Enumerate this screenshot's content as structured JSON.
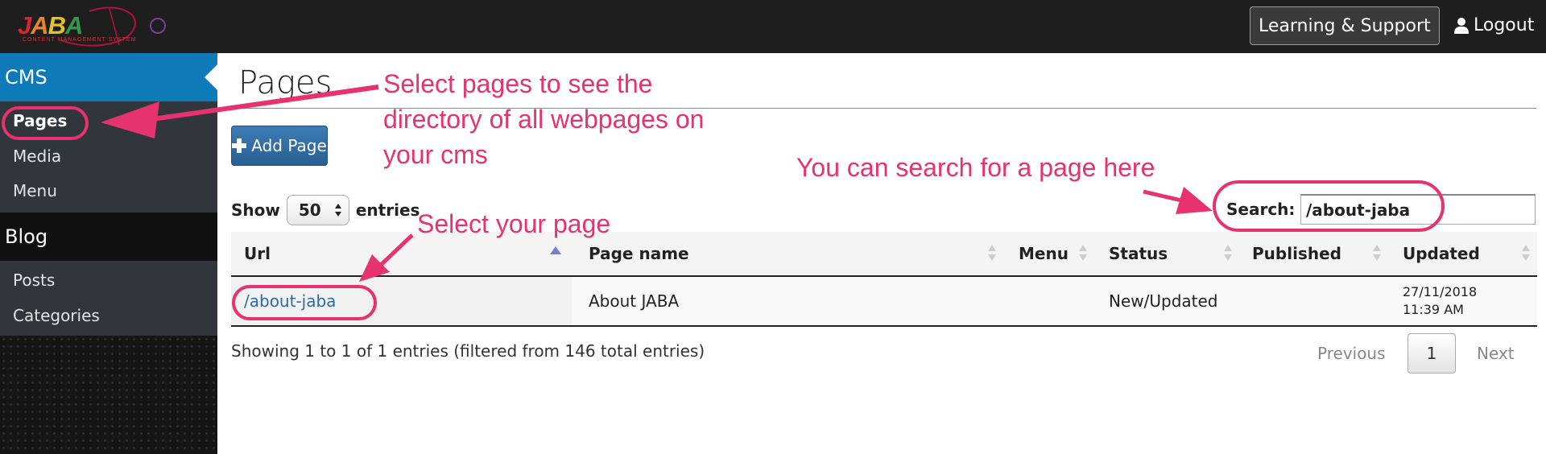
{
  "topbar": {
    "logo_text": "JABA",
    "logo_tagline": "CONTENT MANAGEMENT SYSTEM",
    "learning_label": "Learning & Support",
    "logout_label": "Logout"
  },
  "sidebar": {
    "sections": [
      {
        "label": "CMS",
        "items": [
          "Pages",
          "Media",
          "Menu"
        ]
      },
      {
        "label": "Blog",
        "items": [
          "Posts",
          "Categories"
        ]
      }
    ]
  },
  "main": {
    "title": "Pages",
    "add_button": "Add Page",
    "show_label": "Show",
    "entries_value": "50",
    "entries_label": "entries",
    "search_label": "Search:",
    "search_value": "/about-jaba",
    "columns": [
      "Url",
      "Page name",
      "Menu",
      "Status",
      "Published",
      "Updated"
    ],
    "rows": [
      {
        "url": "/about-jaba",
        "page_name": "About JABA",
        "menu": "",
        "status": "New/Updated",
        "published": "",
        "updated_date": "27/11/2018",
        "updated_time": "11:39 AM"
      }
    ],
    "info": "Showing 1 to 1 of 1 entries (filtered from 146 total entries)",
    "pagination": {
      "previous": "Previous",
      "current": "1",
      "next": "Next"
    }
  },
  "annotations": {
    "pages_line1": "Select pages to see the",
    "pages_line2": "directory of all webpages on",
    "pages_line3": "your cms",
    "search_hint": "You can search for a page here",
    "select_hint": "Select your page"
  },
  "colors": {
    "annotation": "#e6326e",
    "sidebar_active": "#0e7ab8",
    "link": "#2a6ba8"
  }
}
